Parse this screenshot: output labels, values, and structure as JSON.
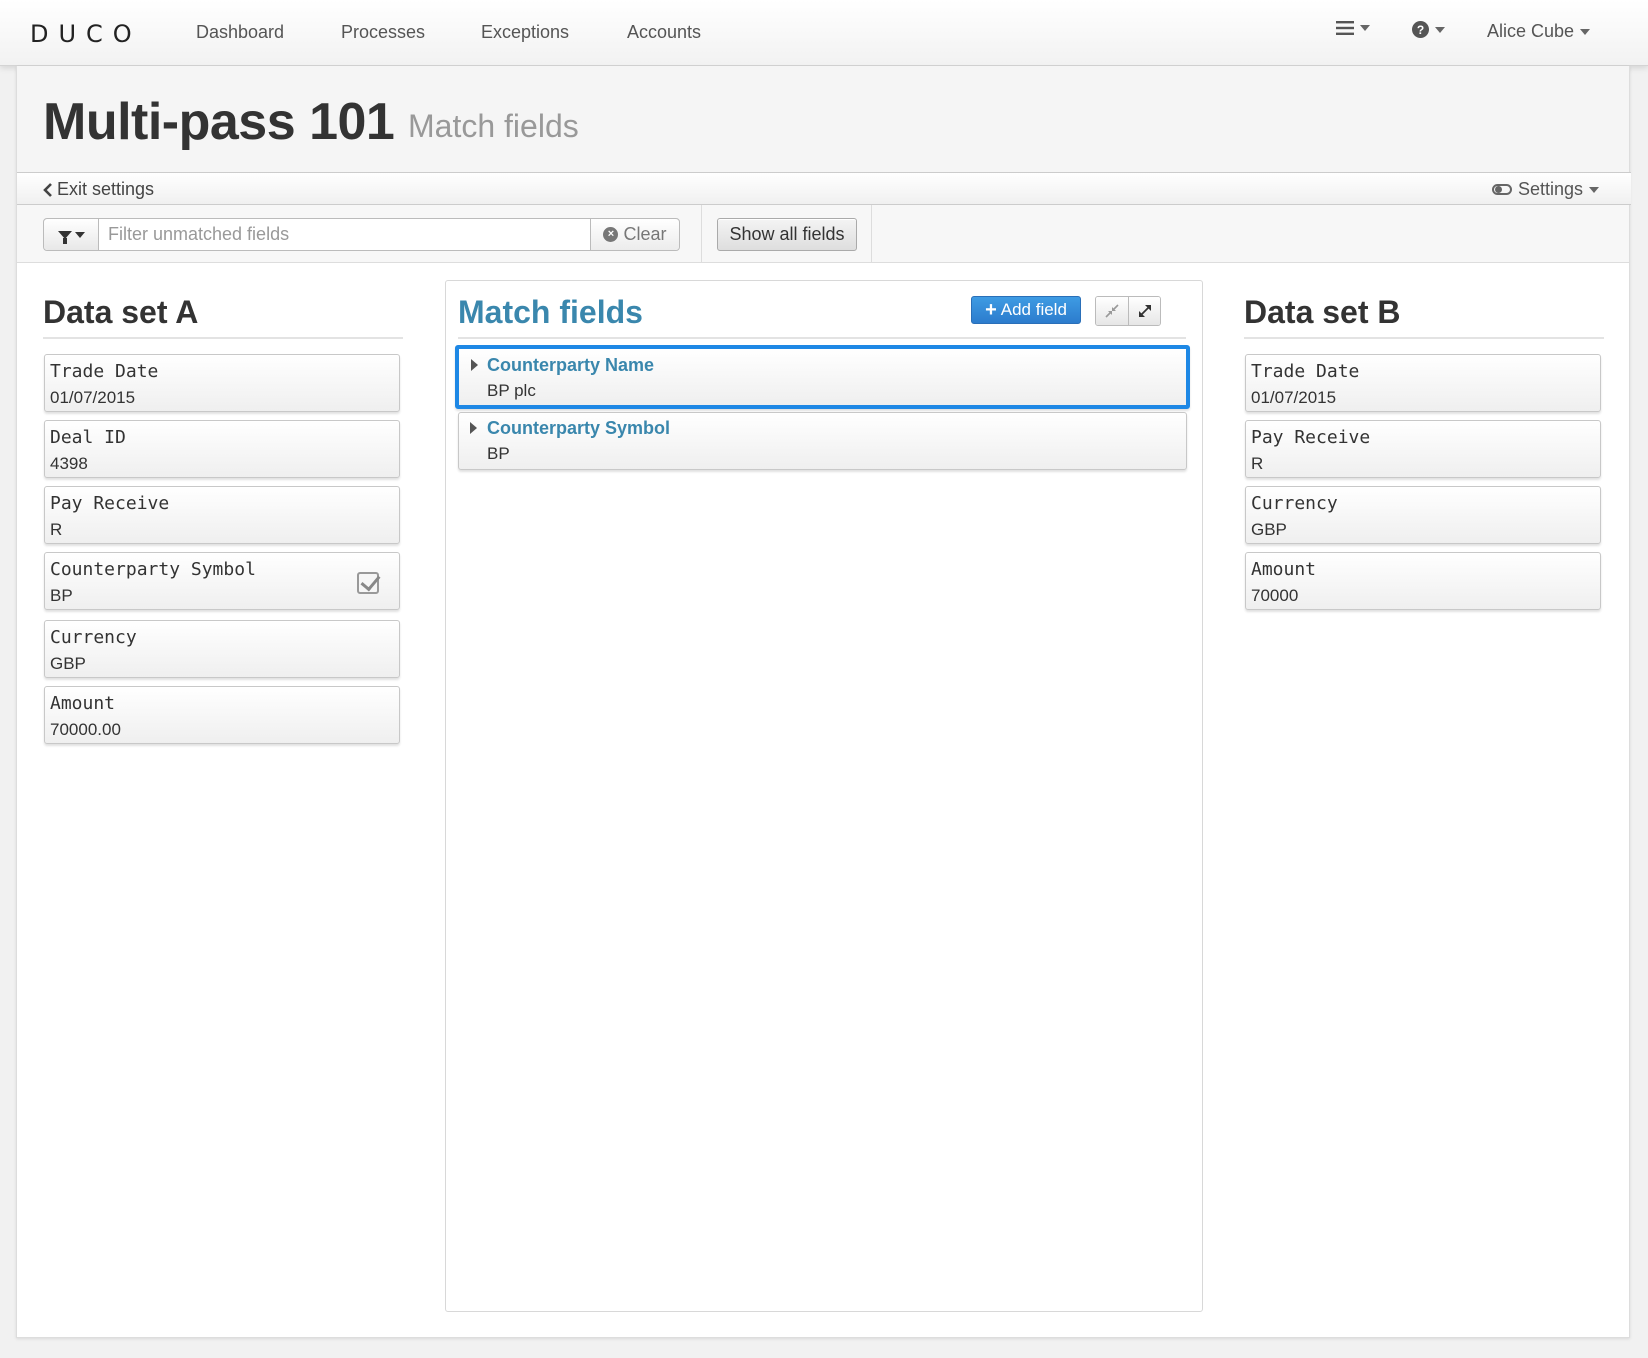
{
  "app": {
    "logo": "DUCO"
  },
  "nav": {
    "links": [
      "Dashboard",
      "Processes",
      "Exceptions",
      "Accounts"
    ],
    "user": "Alice Cube"
  },
  "header": {
    "title": "Multi-pass 101",
    "subtitle": "Match fields"
  },
  "settings_bar": {
    "exit_label": "Exit settings",
    "settings_label": "Settings"
  },
  "filter": {
    "placeholder": "Filter unmatched fields",
    "value": "",
    "clear_label": "Clear",
    "show_all_label": "Show all fields"
  },
  "dataset_a": {
    "heading": "Data set A",
    "fields": [
      {
        "name": "Trade Date",
        "value": "01/07/2015",
        "matched": false
      },
      {
        "name": "Deal ID",
        "value": "4398",
        "matched": false
      },
      {
        "name": "Pay Receive",
        "value": "R",
        "matched": false
      },
      {
        "name": "Counterparty Symbol",
        "value": "BP",
        "matched": true
      },
      {
        "name": "Currency",
        "value": "GBP",
        "matched": false
      },
      {
        "name": "Amount",
        "value": "70000.00",
        "matched": false
      }
    ]
  },
  "match_panel": {
    "heading": "Match fields",
    "add_label": "Add field",
    "fields": [
      {
        "name": "Counterparty Name",
        "value": "BP plc",
        "selected": true
      },
      {
        "name": "Counterparty Symbol",
        "value": "BP",
        "selected": false
      }
    ]
  },
  "dataset_b": {
    "heading": "Data set B",
    "fields": [
      {
        "name": "Trade Date",
        "value": "01/07/2015"
      },
      {
        "name": "Pay Receive",
        "value": "R"
      },
      {
        "name": "Currency",
        "value": "GBP"
      },
      {
        "name": "Amount",
        "value": "70000"
      }
    ]
  },
  "colors": {
    "accent": "#3a87ad",
    "primary_button": "#2c7ccd",
    "selection": "#1e88e5"
  }
}
